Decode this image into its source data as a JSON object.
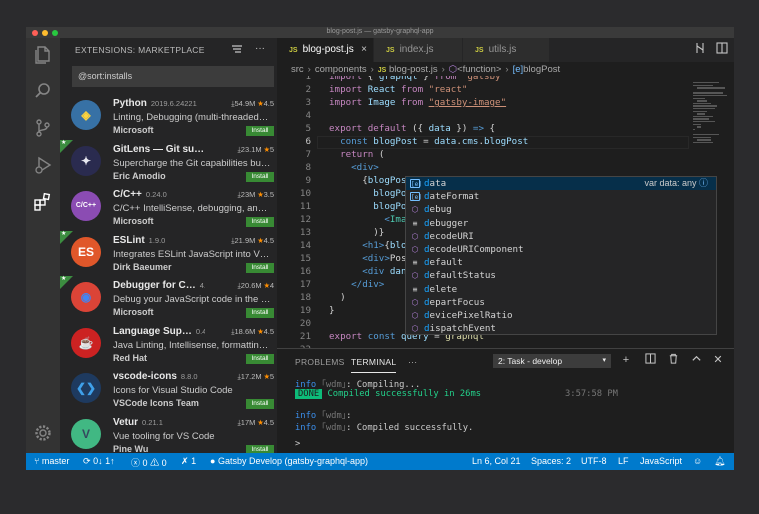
{
  "window": {
    "title": "blog-post.js — gatsby-graphql-app"
  },
  "traffic_lights": [
    "#ff5f57",
    "#febc2e",
    "#28c840"
  ],
  "activity_bar": [
    "files-icon",
    "search-icon",
    "source-control-icon",
    "debug-icon",
    "extensions-icon",
    "settings-gear-icon"
  ],
  "sidebar": {
    "title": "EXTENSIONS: MARKETPLACE",
    "search_value": "@sort:installs",
    "install_label": "Install",
    "extensions": [
      {
        "name": "Python",
        "version": "2019.6.24221",
        "downloads": "54.9M",
        "rating": "4.5",
        "desc": "Linting, Debugging (multi-threaded…",
        "publisher": "Microsoft",
        "logo": "python-logo",
        "starred": false,
        "logo_color": "#3771a5",
        "logo_color2": "#ffd43b"
      },
      {
        "name": "GitLens — Git su…",
        "version": "9.8.5",
        "downloads": "23.1M",
        "rating": "5",
        "desc": "Supercharge the Git capabilities bui…",
        "publisher": "Eric Amodio",
        "logo": "gitlens-logo",
        "starred": true,
        "logo_color": "#2a2b4f",
        "logo_color2": "#e8e8f0"
      },
      {
        "name": "C/C++",
        "version": "0.24.0",
        "downloads": "23M",
        "rating": "3.5",
        "desc": "C/C++ IntelliSense, debugging, and…",
        "publisher": "Microsoft",
        "logo": "cpp-logo",
        "starred": false,
        "logo_color": "#8b4cb3",
        "logo_color2": "#ffffff"
      },
      {
        "name": "ESLint",
        "version": "1.9.0",
        "downloads": "21.9M",
        "rating": "4.5",
        "desc": "Integrates ESLint JavaScript into V…",
        "publisher": "Dirk Baeumer",
        "logo": "eslint-logo",
        "starred": true,
        "logo_color": "#e0572a",
        "logo_color2": "#ffffff"
      },
      {
        "name": "Debugger for C…",
        "version": "4.11.6",
        "downloads": "20.6M",
        "rating": "4",
        "desc": "Debug your JavaScript code in the …",
        "publisher": "Microsoft",
        "logo": "chrome-logo",
        "starred": true,
        "logo_color": "#db4437",
        "logo_color2": "#4285f4"
      },
      {
        "name": "Language Sup…",
        "version": "0.47.0",
        "downloads": "18.6M",
        "rating": "4.5",
        "desc": "Java Linting, Intellisense, formattin…",
        "publisher": "Red Hat",
        "logo": "java-logo",
        "starred": false,
        "logo_color": "#cc2222",
        "logo_color2": "#ffffff"
      },
      {
        "name": "vscode-icons",
        "version": "8.8.0",
        "downloads": "17.2M",
        "rating": "5",
        "desc": "Icons for Visual Studio Code",
        "publisher": "VSCode Icons Team",
        "logo": "vscode-icons-logo",
        "starred": false,
        "logo_color": "#1e3a5f",
        "logo_color2": "#3fa0ea"
      },
      {
        "name": "Vetur",
        "version": "0.21.1",
        "downloads": "17M",
        "rating": "4.5",
        "desc": "Vue tooling for VS Code",
        "publisher": "Pine Wu",
        "logo": "vue-logo",
        "starred": false,
        "logo_color": "#41b883",
        "logo_color2": "#35495e"
      }
    ]
  },
  "tabs": [
    {
      "label": "blog-post.js",
      "active": true,
      "badge": "JS"
    },
    {
      "label": "index.js",
      "active": false,
      "badge": "JS"
    },
    {
      "label": "utils.js",
      "active": false,
      "badge": "JS"
    }
  ],
  "breadcrumbs": [
    "src",
    "components",
    "blog-post.js",
    "<function>",
    "blogPost"
  ],
  "code": {
    "first_line_partial": "import { graphql } from \"gatsby\"",
    "lines": [
      {
        "n": "1",
        "t": ""
      },
      {
        "n": "2",
        "t": ""
      },
      {
        "n": "3",
        "t": ""
      },
      {
        "n": "4",
        "t": ""
      },
      {
        "n": "5",
        "t": ""
      },
      {
        "n": "6",
        "t": ""
      },
      {
        "n": "7",
        "t": ""
      },
      {
        "n": "8",
        "t": ""
      },
      {
        "n": "9",
        "t": ""
      },
      {
        "n": "10",
        "t": ""
      },
      {
        "n": "11",
        "t": ""
      },
      {
        "n": "12",
        "t": ""
      },
      {
        "n": "13",
        "t": ""
      },
      {
        "n": "14",
        "t": ""
      },
      {
        "n": "15",
        "t": ""
      },
      {
        "n": "16",
        "t": ""
      },
      {
        "n": "17",
        "t": ""
      },
      {
        "n": "18",
        "t": ""
      },
      {
        "n": "19",
        "t": ""
      },
      {
        "n": "20",
        "t": ""
      },
      {
        "n": "21",
        "t": ""
      },
      {
        "n": "22",
        "t": ""
      }
    ],
    "cursor_line": "6"
  },
  "suggestions": {
    "match_prefix": "d",
    "items": [
      {
        "label": "data",
        "kind": "variable",
        "detail": "var data: any"
      },
      {
        "label": "dateFormat",
        "kind": "variable",
        "detail": ""
      },
      {
        "label": "debug",
        "kind": "module",
        "detail": ""
      },
      {
        "label": "debugger",
        "kind": "keyword",
        "detail": ""
      },
      {
        "label": "decodeURI",
        "kind": "module",
        "detail": ""
      },
      {
        "label": "decodeURIComponent",
        "kind": "module",
        "detail": ""
      },
      {
        "label": "default",
        "kind": "keyword",
        "detail": ""
      },
      {
        "label": "defaultStatus",
        "kind": "module",
        "detail": ""
      },
      {
        "label": "delete",
        "kind": "keyword",
        "detail": ""
      },
      {
        "label": "departFocus",
        "kind": "module",
        "detail": ""
      },
      {
        "label": "devicePixelRatio",
        "kind": "module",
        "detail": ""
      },
      {
        "label": "dispatchEvent",
        "kind": "module",
        "detail": ""
      }
    ]
  },
  "panel": {
    "tabs": [
      "PROBLEMS",
      "TERMINAL"
    ],
    "active_tab": "TERMINAL",
    "more": "···",
    "task_select": "2: Task - develop",
    "terminal": {
      "l1_level": "info",
      "l1_tag": "｢wdm｣",
      "l1_msg": ": Compiling...",
      "l2_badge": "DONE",
      "l2_msg": " Compiled successfully in 26ms",
      "l2_time": "3:57:58 PM",
      "l3_level": "info",
      "l3_tag": "｢wdm｣",
      "l3_msg": ":",
      "l4_level": "info",
      "l4_tag": "｢wdm｣",
      "l4_msg": ": Compiled successfully.",
      "prompt": ">"
    }
  },
  "status": {
    "branch": "master",
    "sync": "0↓ 1↑",
    "errors": "0",
    "warnings": "0",
    "tools": "1",
    "task": "Gatsby Develop (gatsby-graphql-app)",
    "position": "Ln 6, Col 21",
    "spaces": "Spaces: 2",
    "encoding": "UTF-8",
    "eol": "LF",
    "language": "JavaScript"
  }
}
